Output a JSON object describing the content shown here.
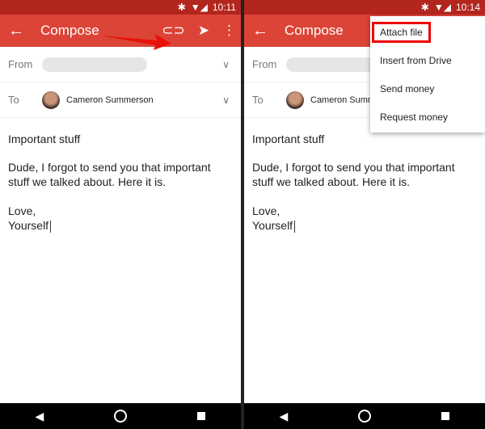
{
  "colors": {
    "status": "#b3261e",
    "toolbar": "#db4437",
    "highlight": "#e00000"
  },
  "left": {
    "time": "10:11",
    "title": "Compose",
    "from_label": "From",
    "to_label": "To",
    "recipient": "Cameron Summerson",
    "subject": "Important stuff",
    "body_line1": "Dude, I forgot to send you that important stuff we talked about. Here it is.",
    "closing": "Love,",
    "signature": "Yourself"
  },
  "right": {
    "time": "10:14",
    "title": "Compose",
    "from_label": "From",
    "to_label": "To",
    "recipient": "Cameron Summ",
    "subject": "Important stuff",
    "body_line1": "Dude, I forgot to send you that important stuff we talked about. Here it is.",
    "closing": "Love,",
    "signature": "Yourself",
    "menu": [
      {
        "label": "Attach file"
      },
      {
        "label": "Insert from Drive"
      },
      {
        "label": "Send money"
      },
      {
        "label": "Request money"
      }
    ]
  },
  "icons": {
    "back": "arrow-left",
    "attach": "paperclip",
    "send": "send",
    "more": "more-vert"
  }
}
